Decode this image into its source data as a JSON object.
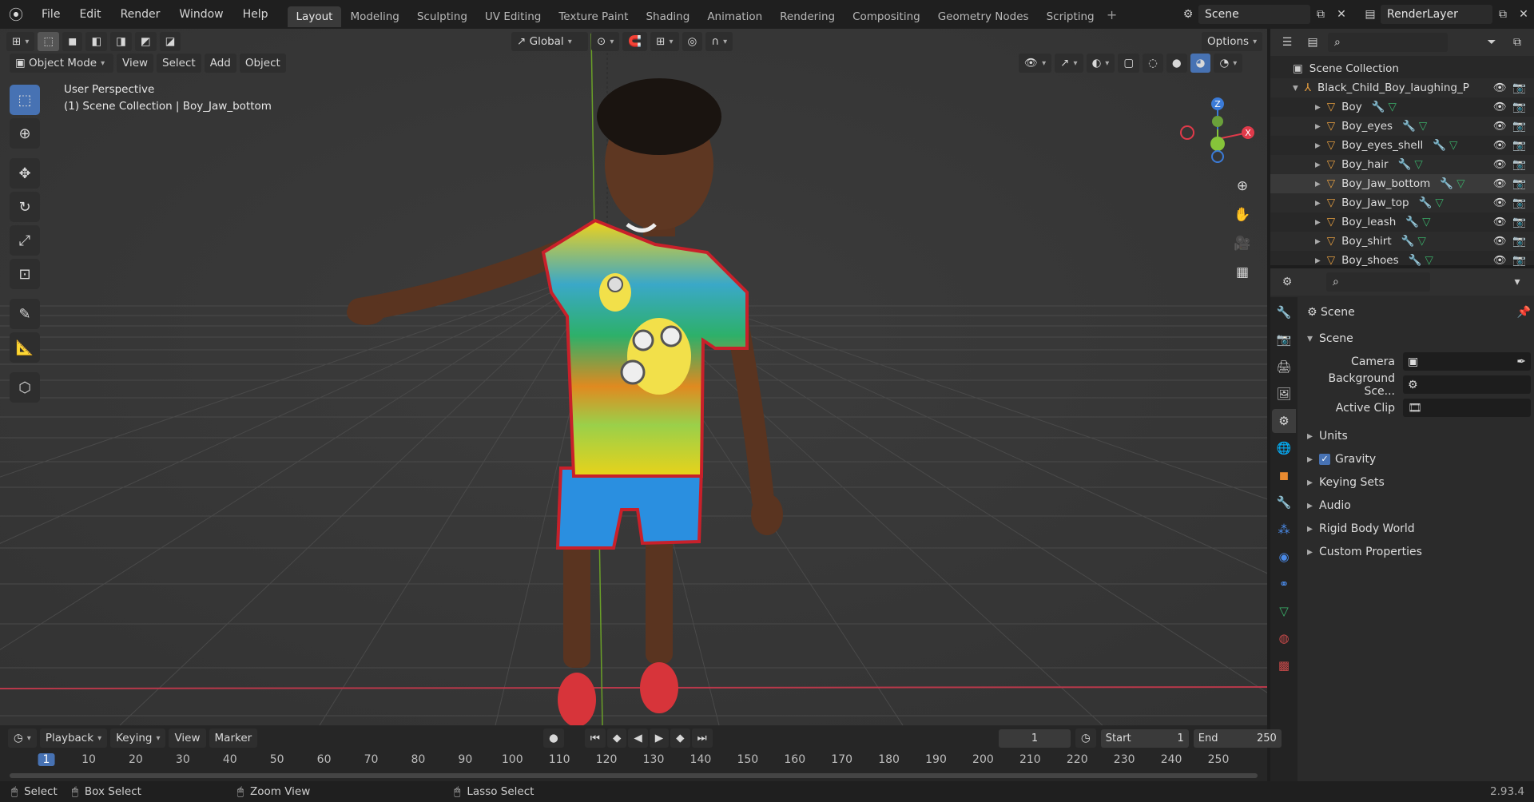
{
  "topbar": {
    "menus": [
      "File",
      "Edit",
      "Render",
      "Window",
      "Help"
    ],
    "workspaces": [
      "Layout",
      "Modeling",
      "Sculpting",
      "UV Editing",
      "Texture Paint",
      "Shading",
      "Animation",
      "Rendering",
      "Compositing",
      "Geometry Nodes",
      "Scripting"
    ],
    "active_workspace": "Layout",
    "scene_name": "Scene",
    "view_layer": "RenderLayer"
  },
  "viewport": {
    "mode": "Object Mode",
    "menus": [
      "View",
      "Select",
      "Add",
      "Object"
    ],
    "transform_orientation": "Global",
    "options_label": "Options",
    "overlay_title": "User Perspective",
    "overlay_subtitle": "(1) Scene Collection | Boy_Jaw_bottom",
    "gizmo_axes": {
      "z": "Z",
      "x": "X"
    }
  },
  "outliner": {
    "root": "Scene Collection",
    "collection": "Black_Child_Boy_laughing_Pc",
    "items": [
      {
        "name": "Boy"
      },
      {
        "name": "Boy_eyes"
      },
      {
        "name": "Boy_eyes_shell"
      },
      {
        "name": "Boy_hair"
      },
      {
        "name": "Boy_Jaw_bottom"
      },
      {
        "name": "Boy_Jaw_top"
      },
      {
        "name": "Boy_leash"
      },
      {
        "name": "Boy_shirt"
      },
      {
        "name": "Boy_shoes"
      }
    ]
  },
  "properties": {
    "context": "Scene",
    "panel": "Scene",
    "camera_label": "Camera",
    "background_label": "Background Sce...",
    "active_clip_label": "Active Clip",
    "sections": [
      "Units",
      "Gravity",
      "Keying Sets",
      "Audio",
      "Rigid Body World",
      "Custom Properties"
    ],
    "gravity_checked": true
  },
  "timeline": {
    "menus": [
      "Playback",
      "Keying",
      "View",
      "Marker"
    ],
    "current_frame": "1",
    "start_label": "Start",
    "start": "1",
    "end_label": "End",
    "end": "250",
    "ticks": [
      "1",
      "10",
      "20",
      "30",
      "40",
      "50",
      "60",
      "70",
      "80",
      "90",
      "100",
      "110",
      "120",
      "130",
      "140",
      "150",
      "160",
      "170",
      "180",
      "190",
      "200",
      "210",
      "220",
      "230",
      "240",
      "250"
    ]
  },
  "status": {
    "select": "Select",
    "box_select": "Box Select",
    "zoom_view": "Zoom View",
    "lasso_select": "Lasso Select",
    "version": "2.93.4"
  },
  "colors": {
    "accent": "#4772b3",
    "x_axis": "#e03a4a",
    "y_axis": "#86c43a",
    "z_axis": "#3b7bd8"
  }
}
